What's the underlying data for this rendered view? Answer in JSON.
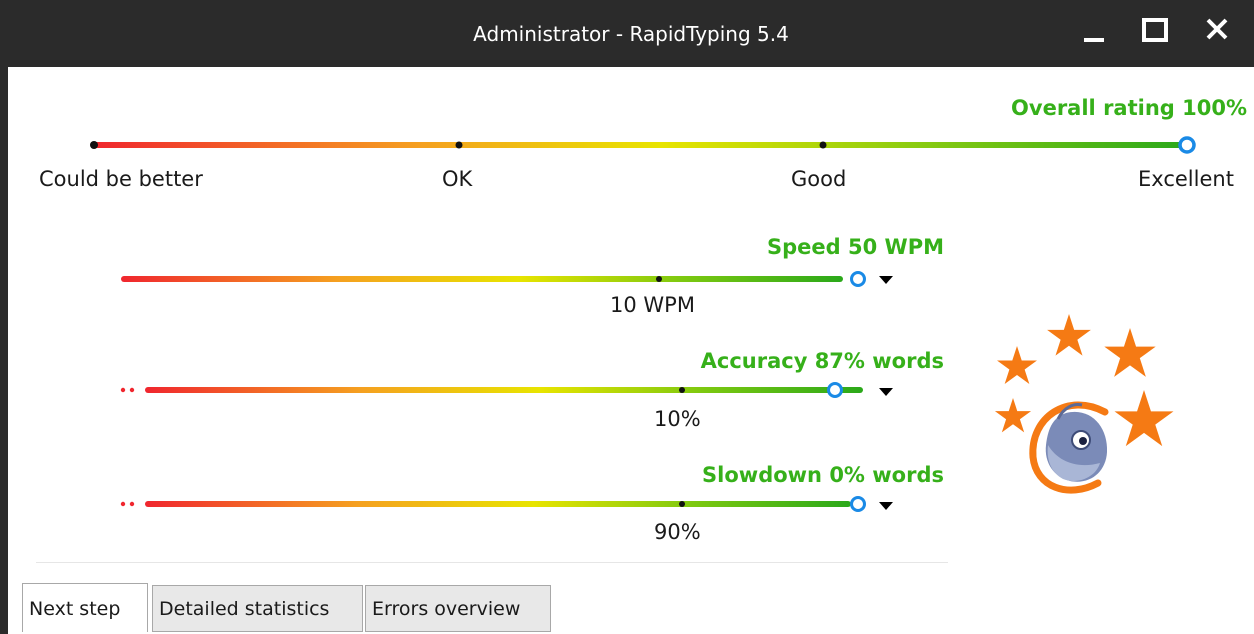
{
  "window": {
    "title": "Administrator - RapidTyping 5.4"
  },
  "overall": {
    "label": "Overall rating 100%",
    "ticks": [
      "Could be better",
      "OK",
      "Good",
      "Excellent"
    ]
  },
  "speed": {
    "label": "Speed 50 WPM",
    "marker_label": "10 WPM",
    "level": 0.95
  },
  "accuracy": {
    "label": "Accuracy 87% words",
    "marker_label": "10%",
    "level": 0.87
  },
  "slowdown": {
    "label": "Slowdown 0% words",
    "marker_label": "90%",
    "level": 1.0
  },
  "tabs": [
    {
      "label": "Next step",
      "active": true
    },
    {
      "label": "Detailed statistics",
      "active": false
    },
    {
      "label": "Errors overview",
      "active": false
    }
  ],
  "colors": {
    "gradient_start": "#f0262e",
    "gradient_mid": "#e8e000",
    "gradient_end": "#2aa81a",
    "marker": "#1a8ae6",
    "label_green": "#36b01a",
    "star": "#f57a14"
  },
  "icons": [
    "minimize-icon",
    "maximize-icon",
    "close-icon",
    "star-icon",
    "dolphin-logo-icon",
    "dropdown-arrow-icon"
  ]
}
